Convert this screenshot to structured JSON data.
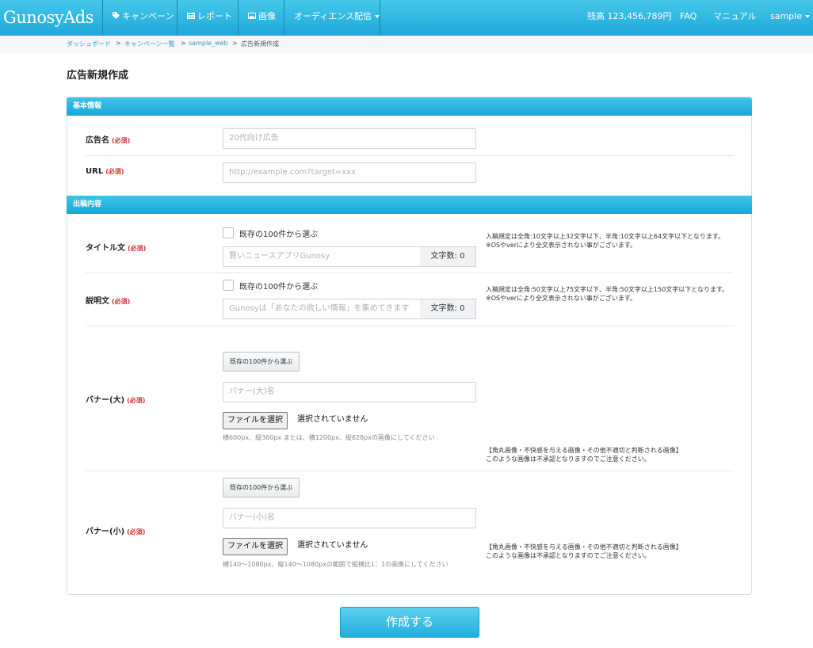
{
  "nav": {
    "logo": "GunosyAds",
    "campaign": "キャンペーン",
    "report": "レポート",
    "image": "画像",
    "audience": "オーディエンス配信",
    "balance": "残高 123,456,789円",
    "faq": "FAQ",
    "manual": "マニュアル",
    "user": "sample"
  },
  "breadcrumb": {
    "dashboard": "ダッシュボード",
    "campaign_list": "キャンペーン一覧",
    "campaign": "sample_web",
    "current": "広告新規作成",
    "sep": ">"
  },
  "page_title": "広告新規作成",
  "required": "(必須)",
  "sections": {
    "basic": "基本情報",
    "content": "出稿内容"
  },
  "fields": {
    "ad_name": {
      "label": "広告名",
      "placeholder": "20代向け広告"
    },
    "url": {
      "label": "URL",
      "placeholder": "http://example.com?target=xxx"
    },
    "title": {
      "label": "タイトル文",
      "checkbox": "既存の100件から選ぶ",
      "placeholder": "賢いニュースアプリGunosy",
      "count": "文字数: 0",
      "note1": "入稿規定は全角:10文字以上32文字以下、半角:10文字以上64文字以下となります。",
      "note2": "※OSやverにより全文表示されない事がございます。"
    },
    "description": {
      "label": "説明文",
      "checkbox": "既存の100件から選ぶ",
      "placeholder": "Gunosyは「あなたの欲しい情報」を集めてきます",
      "count": "文字数: 0",
      "note1": "入稿規定は全角:50文字以上75文字以下、半角:50文字以上150文字以下となります。",
      "note2": "※OSやverにより全文表示されない事がございます。"
    },
    "banner_large": {
      "label": "バナー(大)",
      "select_button": "既存の100件から選ぶ",
      "placeholder": "バナー(大)名",
      "file_button": "ファイルを選択",
      "file_status": "選択されていません",
      "hint": "横600px、縦360px または、横1200px、縦628pxの画像にしてください",
      "note1": "【角丸画像・不快感を与える画像・その他不適切と判断される画像】",
      "note2": "このような画像は不承認となりますのでご注意ください。"
    },
    "banner_small": {
      "label": "バナー(小)",
      "select_button": "既存の100件から選ぶ",
      "placeholder": "バナー(小)名",
      "file_button": "ファイルを選択",
      "file_status": "選択されていません",
      "hint": "横140〜1080px、縦140〜1080pxの範囲で縦横比1：1の画像にしてください",
      "note1": "【角丸画像・不快感を与える画像・その他不適切と判断される画像】",
      "note2": "このような画像は不承認となりますのでご注意ください。"
    }
  },
  "submit": "作成する"
}
